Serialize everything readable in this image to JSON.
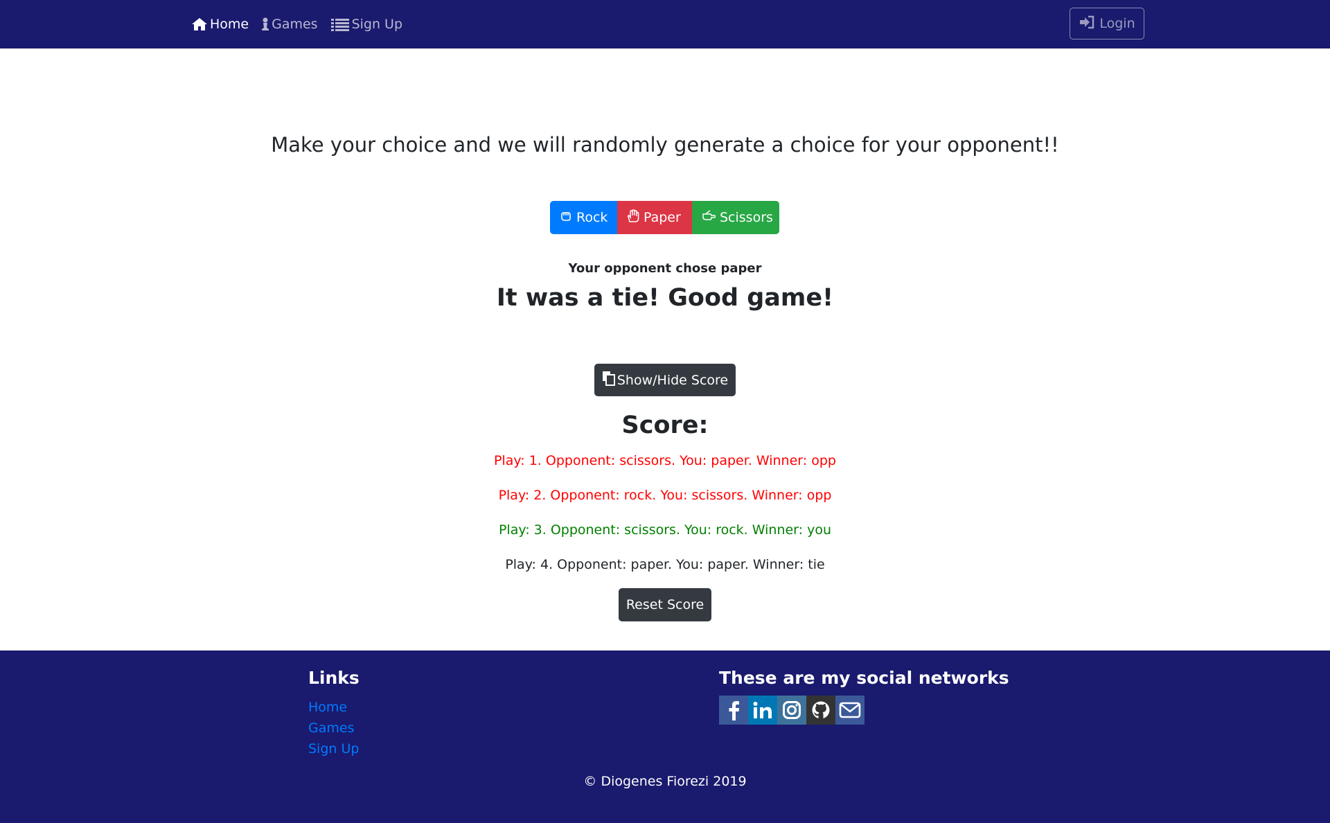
{
  "navbar": {
    "links": [
      {
        "label": "Home",
        "icon": "home-icon",
        "active": true
      },
      {
        "label": "Games",
        "icon": "chess-pawn-icon",
        "active": false
      },
      {
        "label": "Sign Up",
        "icon": "list-icon",
        "active": false
      }
    ],
    "login_label": "Login",
    "login_icon": "sign-in-icon"
  },
  "game": {
    "headline": "Make your choice and we will randomly generate a choice for your opponent!!",
    "choices": [
      {
        "label": "Rock",
        "icon": "hand-rock-icon",
        "color": "#007bff"
      },
      {
        "label": "Paper",
        "icon": "hand-paper-icon",
        "color": "#dc3545"
      },
      {
        "label": "Scissors",
        "icon": "hand-scissors-icon",
        "color": "#28a745"
      }
    ],
    "opponent_chose": "Your opponent chose paper",
    "result": "It was a tie! Good game!"
  },
  "score": {
    "toggle_label": "Show/Hide Score",
    "toggle_icon": "copy-icon",
    "title": "Score:",
    "plays": [
      {
        "text": "Play: 1. Opponent: scissors. You: paper. Winner: opp",
        "color": "#ff0000"
      },
      {
        "text": "Play: 2. Opponent: rock. You: scissors. Winner: opp",
        "color": "#ff0000"
      },
      {
        "text": "Play: 3. Opponent: scissors. You: rock. Winner: you",
        "color": "#008000"
      },
      {
        "text": "Play: 4. Opponent: paper. You: paper. Winner: tie",
        "color": "#212529"
      }
    ],
    "reset_label": "Reset Score"
  },
  "footer": {
    "links_title": "Links",
    "links": [
      "Home",
      "Games",
      "Sign Up"
    ],
    "social_title": "These are my social networks",
    "social": [
      {
        "icon": "facebook-icon",
        "color": "#3b5998"
      },
      {
        "icon": "linkedin-icon",
        "color": "#0077b5"
      },
      {
        "icon": "instagram-icon",
        "color": "#3f729b"
      },
      {
        "icon": "github-icon",
        "color": "#333333"
      },
      {
        "icon": "envelope-icon",
        "color": "#3b5998"
      }
    ],
    "copyright": "© Diogenes Fiorezi 2019"
  },
  "colors": {
    "navbar_bg": "#1a1a6e",
    "footer_bg": "#1a1a6e",
    "dark_button": "#343a40",
    "link": "#007bff"
  }
}
